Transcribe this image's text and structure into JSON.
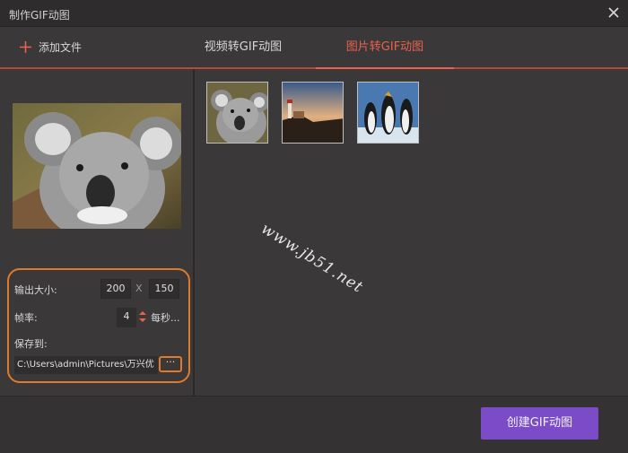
{
  "window": {
    "title": "制作GIF动图"
  },
  "toolbar": {
    "add_file_label": "添加文件"
  },
  "tabs": [
    {
      "label": "视频转GIF动图",
      "active": false
    },
    {
      "label": "图片转GIF动图",
      "active": true
    }
  ],
  "settings": {
    "size_label": "输出大小:",
    "width": "200",
    "x_separator": "X",
    "height": "150",
    "fps_label": "帧率:",
    "fps_value": "4",
    "fps_unit": "每秒...",
    "save_label": "保存到:",
    "save_path": "C:\\Users\\admin\\Pictures\\万兴优",
    "browse_label": "···"
  },
  "thumbnails": [
    {
      "name": "koala"
    },
    {
      "name": "lighthouse"
    },
    {
      "name": "penguins"
    }
  ],
  "watermark": "www.jb51.net",
  "footer": {
    "create_label": "创建GIF动图"
  },
  "colors": {
    "accent": "#e8624e",
    "highlight": "#e07a2a",
    "button": "#7b4bc8"
  }
}
